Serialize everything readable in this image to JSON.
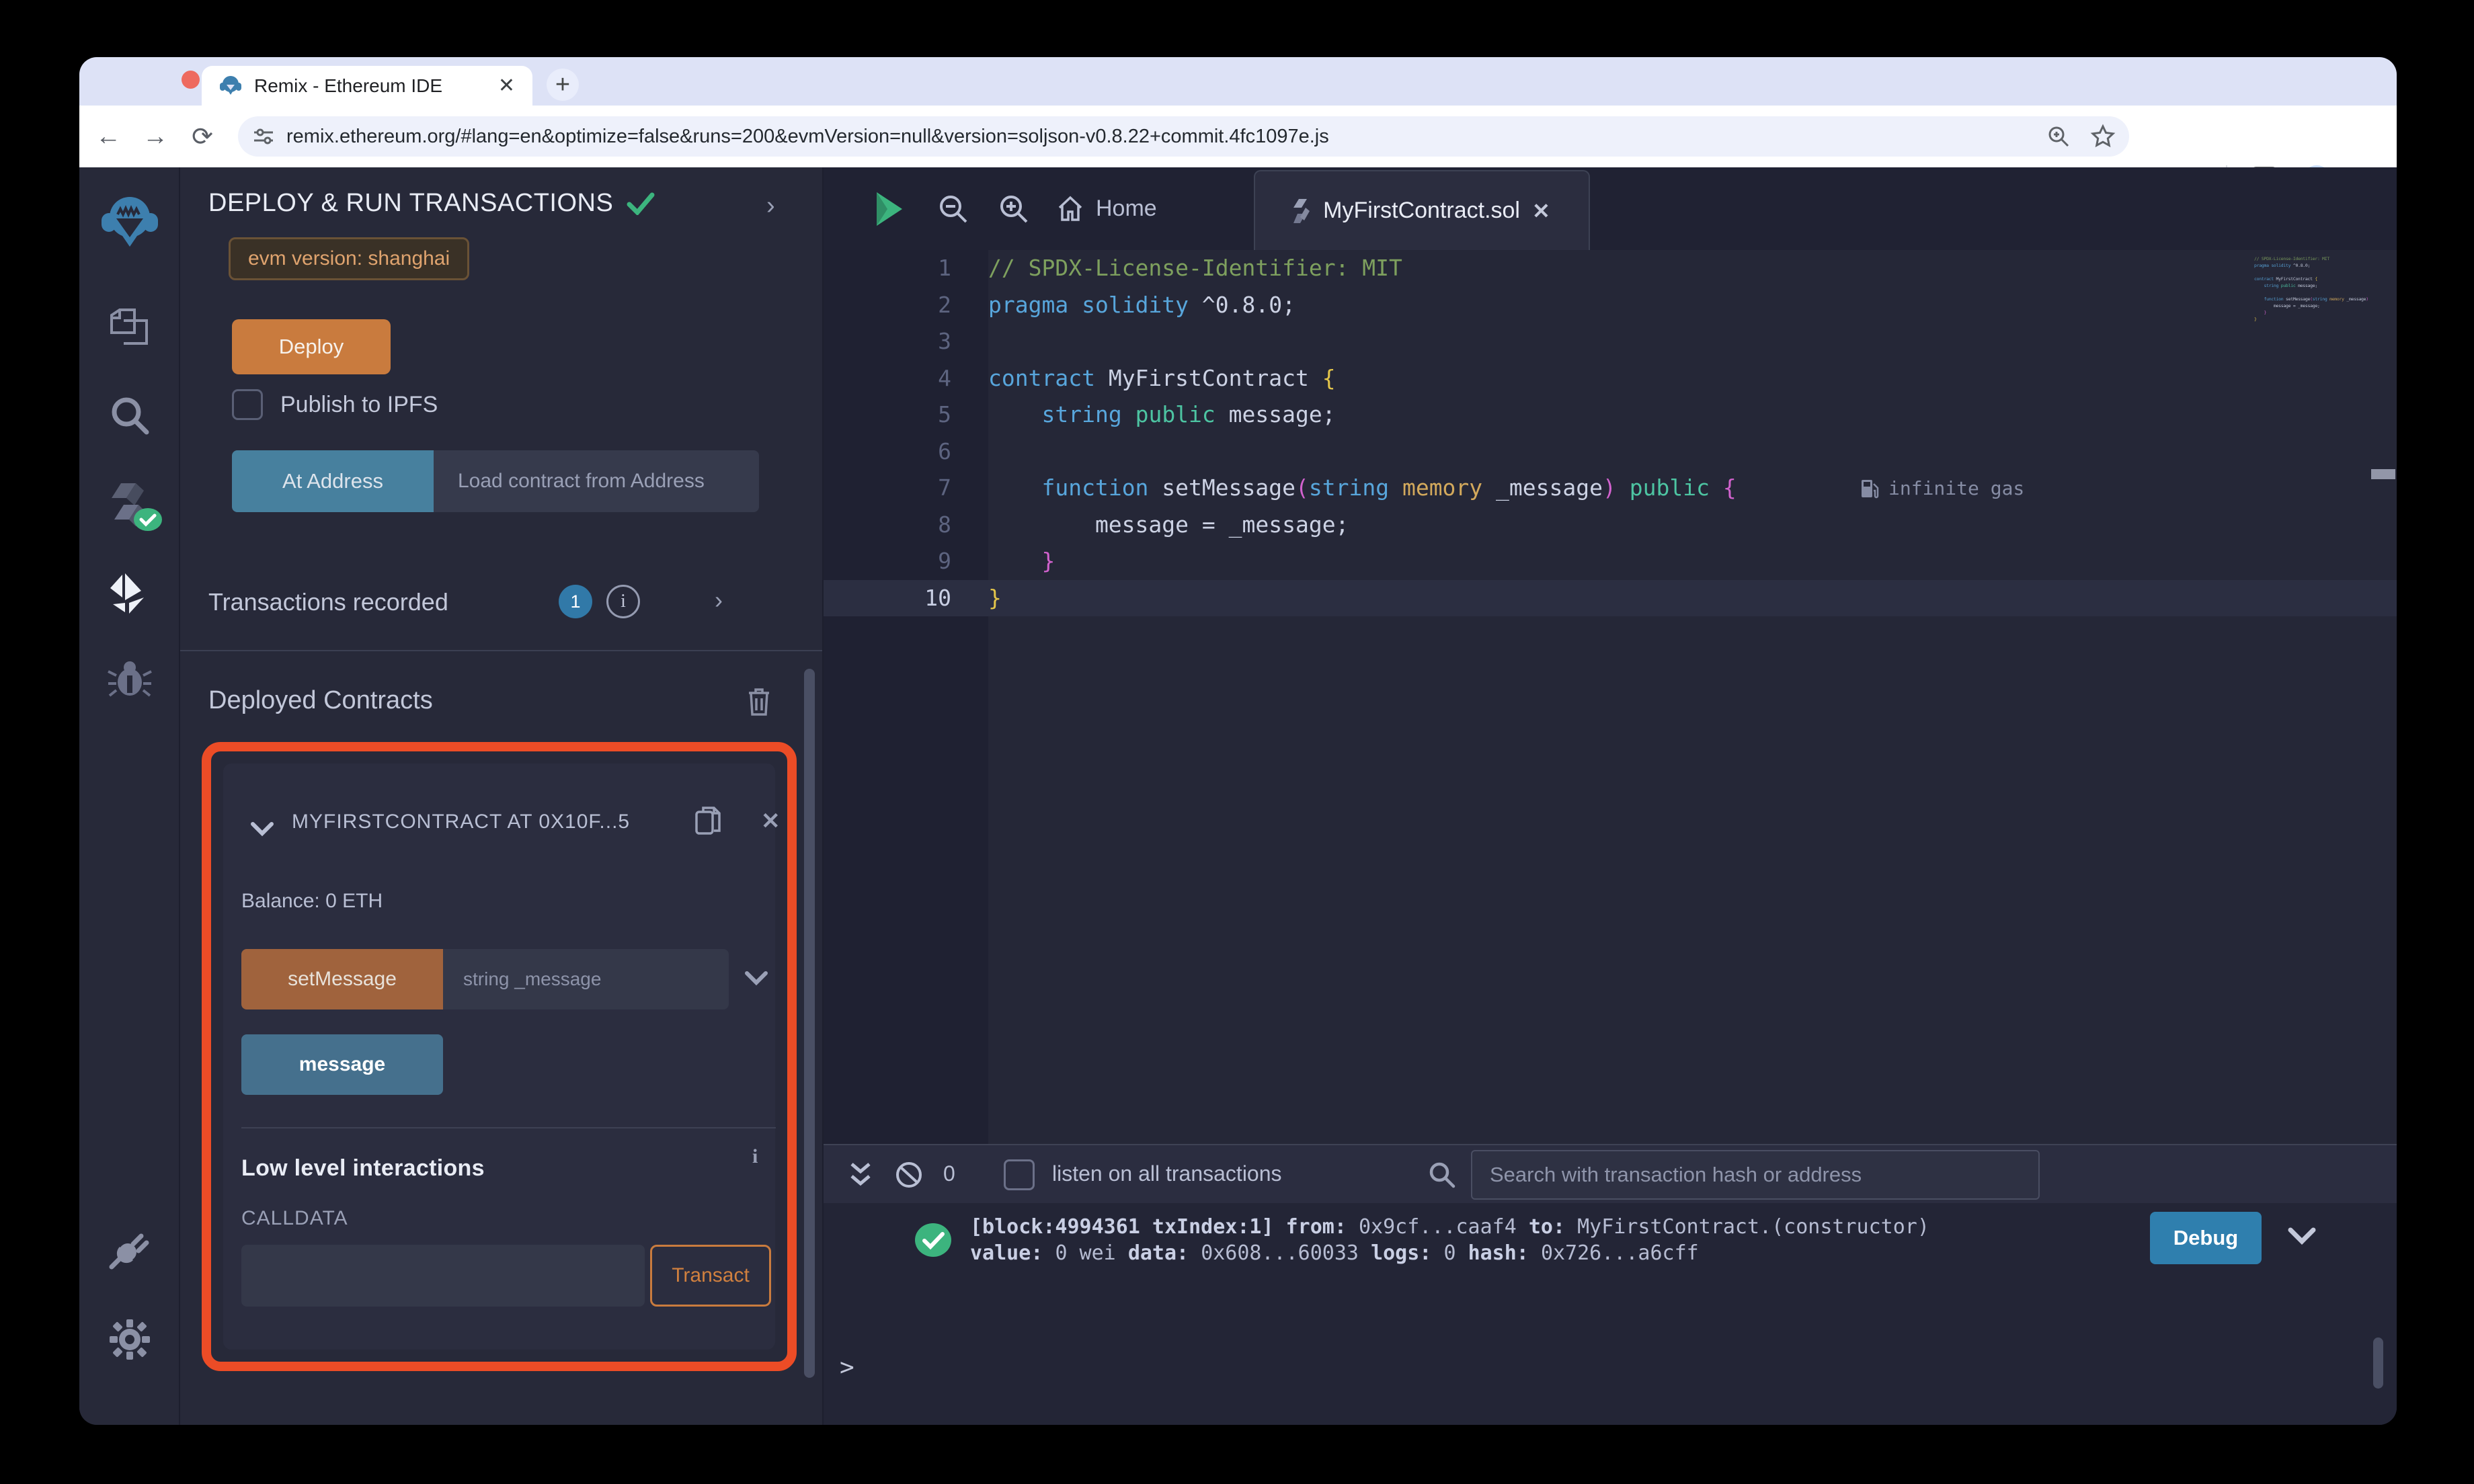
{
  "browser": {
    "tab_title": "Remix - Ethereum IDE",
    "url": "remix.ethereum.org/#lang=en&optimize=false&runs=200&evmVersion=null&version=soljson-v0.8.22+commit.4fc1097e.js"
  },
  "side_panel": {
    "title": "DEPLOY & RUN TRANSACTIONS",
    "evm_badge": "evm version: shanghai",
    "deploy_label": "Deploy",
    "publish_label": "Publish to IPFS",
    "at_address_label": "At Address",
    "at_address_placeholder": "Load contract from Address",
    "transactions_recorded_label": "Transactions recorded",
    "transactions_recorded_count": "1",
    "info_glyph": "i",
    "deployed_contracts_title": "Deployed Contracts",
    "contract": {
      "title": "MYFIRSTCONTRACT AT 0X10F...5",
      "balance": "Balance: 0 ETH",
      "set_message_label": "setMessage",
      "set_message_placeholder": "string _message",
      "message_label": "message",
      "low_level_title": "Low level interactions",
      "calldata_label": "CALLDATA",
      "transact_label": "Transact"
    }
  },
  "editor": {
    "home_tab_label": "Home",
    "file_tab_label": "MyFirstContract.sol",
    "gas_annotation": "infinite gas",
    "code_lines": [
      {
        "tokens": [
          [
            "// SPDX-License-Identifier: MIT",
            "com"
          ]
        ]
      },
      {
        "tokens": [
          [
            "pragma",
            "kw"
          ],
          [
            " ",
            "pl"
          ],
          [
            "solidity",
            "kw"
          ],
          [
            " ^0.8.0;",
            "pl"
          ]
        ]
      },
      {
        "tokens": []
      },
      {
        "tokens": [
          [
            "contract",
            "kw"
          ],
          [
            " MyFirstContract ",
            "pl"
          ],
          [
            "{",
            "by"
          ]
        ]
      },
      {
        "tokens": [
          [
            "    ",
            "pl"
          ],
          [
            "string",
            "kw"
          ],
          [
            " ",
            "pl"
          ],
          [
            "public",
            "grn"
          ],
          [
            " message;",
            "pl"
          ]
        ]
      },
      {
        "tokens": []
      },
      {
        "tokens": [
          [
            "    ",
            "pl"
          ],
          [
            "function",
            "kw"
          ],
          [
            " setMessage",
            "pl"
          ],
          [
            "(",
            "bp"
          ],
          [
            "string",
            "kw"
          ],
          [
            " ",
            "pl"
          ],
          [
            "memory",
            "mem"
          ],
          [
            " _message",
            "pl"
          ],
          [
            ")",
            "bp"
          ],
          [
            " ",
            "pl"
          ],
          [
            "public",
            "grn"
          ],
          [
            " ",
            "pl"
          ],
          [
            "{",
            "bp"
          ]
        ],
        "annotated": true
      },
      {
        "tokens": [
          [
            "        message = _message;",
            "pl"
          ]
        ]
      },
      {
        "tokens": [
          [
            "    ",
            "pl"
          ],
          [
            "}",
            "bp"
          ]
        ]
      },
      {
        "tokens": [
          [
            "}",
            "by"
          ]
        ],
        "active": true
      }
    ]
  },
  "terminal": {
    "badge_count": "0",
    "listen_label": "listen on all transactions",
    "search_placeholder": "Search with transaction hash or address",
    "debug_label": "Debug",
    "prompt": ">",
    "log_lines": [
      [
        [
          "[block:4994361 txIndex:1] ",
          "b"
        ],
        [
          "from: ",
          "b"
        ],
        [
          "0x9cf...caaf4 ",
          ""
        ],
        [
          "to: ",
          "b"
        ],
        [
          "MyFirstContract.(constructor) ",
          ""
        ]
      ],
      [
        [
          "value: ",
          "b"
        ],
        [
          "0 wei ",
          ""
        ],
        [
          "data: ",
          "b"
        ],
        [
          "0x608...60033 ",
          ""
        ],
        [
          "logs: ",
          "b"
        ],
        [
          "0 ",
          ""
        ],
        [
          "hash: ",
          "b"
        ],
        [
          "0x726...a6cff",
          ""
        ]
      ]
    ]
  },
  "colors": {
    "accent_red": "#ec4c26",
    "deploy_orange": "#c97b3e",
    "set_message_brown": "#a0633d",
    "at_address_teal": "#47809e",
    "message_blue": "#45708d",
    "debug_blue": "#2f7fae",
    "success_green": "#3cb47e",
    "badge_blue": "#3179a8",
    "transact_orange": "#d0803f"
  }
}
